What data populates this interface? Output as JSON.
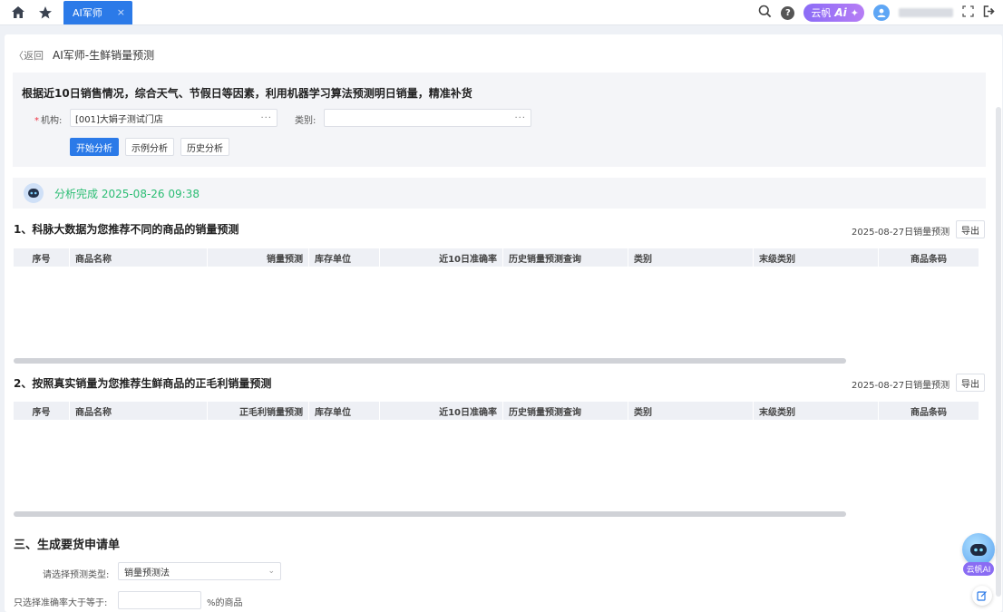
{
  "topbar": {
    "tab_label": "AI军师",
    "tab_close": "×",
    "help": "?",
    "ai_badge_text": "云帆",
    "ai_badge_logo": "Ai",
    "ai_badge_star": "✦"
  },
  "page": {
    "back_label": "〈返回",
    "title": "AI军师-生鲜销量预测"
  },
  "filter": {
    "heading": "根据近10日销售情况，综合天气、节假日等因素，利用机器学习算法预测明日销量，精准补货",
    "org_label": "机构:",
    "org_value": "[001]大娟子测试门店",
    "category_label": "类别:",
    "category_value": "",
    "dots": "···",
    "btn_start": "开始分析",
    "btn_example": "示例分析",
    "btn_history": "历史分析"
  },
  "status": {
    "text": "分析完成 2025-08-26 09:38"
  },
  "section1": {
    "title": "1、科脉大数据为您推荐不同的商品的销量预测",
    "date_label": "2025-08-27日销量预测",
    "export_label": "导出",
    "columns": [
      "序号",
      "商品名称",
      "销量预测",
      "库存单位",
      "近10日准确率",
      "历史销量预测查询",
      "类别",
      "末级类别",
      "商品条码"
    ]
  },
  "section2": {
    "title": "2、按照真实销量为您推荐生鲜商品的正毛利销量预测",
    "date_label": "2025-08-27日销量预测",
    "export_label": "导出",
    "columns": [
      "序号",
      "商品名称",
      "正毛利销量预测",
      "库存单位",
      "近10日准确率",
      "历史销量预测查询",
      "类别",
      "末级类别",
      "商品条码"
    ]
  },
  "section3": {
    "title": "三、生成要货申请单",
    "type_label": "请选择预测类型:",
    "type_value": "销量预测法",
    "accuracy_label": "只选择准确率大于等于:",
    "accuracy_value": "",
    "accuracy_suffix": "%的商品"
  },
  "fab": {
    "label": "云帆AI"
  },
  "colors": {
    "primary": "#2b7ae8",
    "success": "#2bbd73",
    "ai_purple": "#8a6cf3"
  }
}
